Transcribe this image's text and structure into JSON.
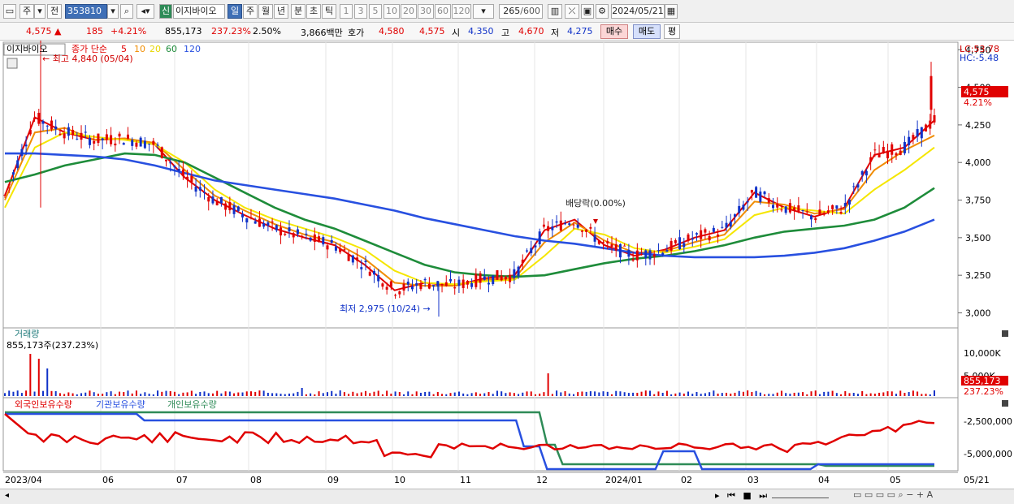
{
  "toolbar": {
    "market": "주",
    "prev": "전",
    "code": "353810",
    "name": "이지바이오",
    "new_label": "신",
    "periods": [
      "일",
      "주",
      "월",
      "년",
      "분",
      "초",
      "틱"
    ],
    "intervals": [
      "1",
      "3",
      "5",
      "10",
      "20",
      "30",
      "60",
      "120"
    ],
    "count": "265",
    "count_max": "/600",
    "date": "2024/05/21"
  },
  "quote": {
    "price": "4,575",
    "change": "185",
    "change_pct": "+4.21%",
    "volume": "855,173",
    "volume_ratio": "237.23%",
    "turnover": "2.50%",
    "amount": "3,866백만",
    "ask_label": "호가",
    "ask1": "4,580",
    "ask2": "4,575",
    "open_label": "시",
    "open": "4,350",
    "high_label": "고",
    "high": "4,670",
    "low_label": "저",
    "low": "4,275",
    "buy": "매수",
    "sell": "매도",
    "eval": "평"
  },
  "price_panel": {
    "stock_label": "이지바이오",
    "ma_label": "종가 단순",
    "ma_periods": [
      "5",
      "10",
      "20",
      "60",
      "120"
    ],
    "ma_colors": [
      "#e00000",
      "#f08c00",
      "#f5e600",
      "#1e8c3a",
      "#2850e0"
    ],
    "high_marker": "최고 4,840 (05/04)",
    "low_marker": "최저 2,975 (10/24)",
    "dividend_marker": "배당락(0.00%)",
    "lc": "LC:53.78",
    "hc": "HC:-5.48",
    "last_price_tag": "4,575",
    "last_pct_tag": "4.21%"
  },
  "volume_panel": {
    "title": "거래량",
    "info": "855,173주(237.23%)",
    "axis": [
      "10,000K",
      "5,000K"
    ],
    "last_tag": "855,173",
    "last_pct": "237.23%"
  },
  "holdings_panel": {
    "series": [
      "외국인보유수량",
      "기관보유수량",
      "개인보유수량"
    ],
    "colors": [
      "#e00000",
      "#2850e0",
      "#2e8b57"
    ],
    "axis": [
      "-2,500,000",
      "-5,000,000"
    ]
  },
  "x_axis": [
    "2023/04",
    "06",
    "07",
    "08",
    "09",
    "10",
    "11",
    "12",
    "2024/01",
    "02",
    "03",
    "04",
    "05",
    "05/21"
  ],
  "chart_data": {
    "type": "line",
    "ylim": [
      2900,
      4800
    ],
    "y_ticks": [
      4750,
      4500,
      4250,
      4000,
      3750,
      3500,
      3250,
      3000
    ],
    "y_tick_labels": [
      "4,750",
      "4,500",
      "4,250",
      "4,000",
      "3,750",
      "3,500",
      "3,250",
      "3,000"
    ],
    "x_months": [
      "2023/04",
      "06",
      "07",
      "08",
      "09",
      "10",
      "11",
      "12",
      "2024/01",
      "02",
      "03",
      "04",
      "05",
      "05/21"
    ],
    "series": [
      {
        "name": "5",
        "values": [
          3780,
          4300,
          4200,
          4150,
          4160,
          4120,
          3900,
          3750,
          3650,
          3560,
          3500,
          3450,
          3320,
          3150,
          3200,
          3180,
          3230,
          3250,
          3550,
          3620,
          3450,
          3380,
          3420,
          3500,
          3550,
          3800,
          3700,
          3640,
          3700,
          4050,
          4100,
          4280
        ]
      },
      {
        "name": "10",
        "values": [
          3750,
          4200,
          4230,
          4150,
          4160,
          4130,
          3950,
          3780,
          3680,
          3590,
          3520,
          3470,
          3360,
          3200,
          3180,
          3180,
          3220,
          3230,
          3470,
          3600,
          3480,
          3400,
          3410,
          3470,
          3520,
          3740,
          3720,
          3660,
          3690,
          3950,
          4080,
          4180
        ]
      },
      {
        "name": "20",
        "values": [
          3700,
          4100,
          4200,
          4170,
          4150,
          4120,
          4000,
          3820,
          3700,
          3620,
          3560,
          3500,
          3420,
          3280,
          3200,
          3190,
          3210,
          3220,
          3380,
          3560,
          3520,
          3430,
          3400,
          3440,
          3490,
          3650,
          3700,
          3680,
          3660,
          3820,
          3950,
          4100
        ]
      },
      {
        "name": "60",
        "values": [
          3870,
          3920,
          3980,
          4020,
          4060,
          4050,
          4000,
          3900,
          3800,
          3700,
          3620,
          3560,
          3480,
          3400,
          3320,
          3270,
          3250,
          3240,
          3250,
          3290,
          3330,
          3360,
          3380,
          3410,
          3450,
          3500,
          3540,
          3560,
          3580,
          3620,
          3700,
          3830
        ]
      },
      {
        "name": "120",
        "values": [
          4060,
          4060,
          4050,
          4040,
          4020,
          3980,
          3930,
          3880,
          3850,
          3820,
          3790,
          3760,
          3720,
          3680,
          3630,
          3590,
          3550,
          3510,
          3480,
          3460,
          3430,
          3400,
          3380,
          3370,
          3370,
          3370,
          3380,
          3400,
          3430,
          3480,
          3540,
          3620
        ]
      }
    ],
    "high": 4840,
    "low": 2975,
    "last": 4575
  }
}
